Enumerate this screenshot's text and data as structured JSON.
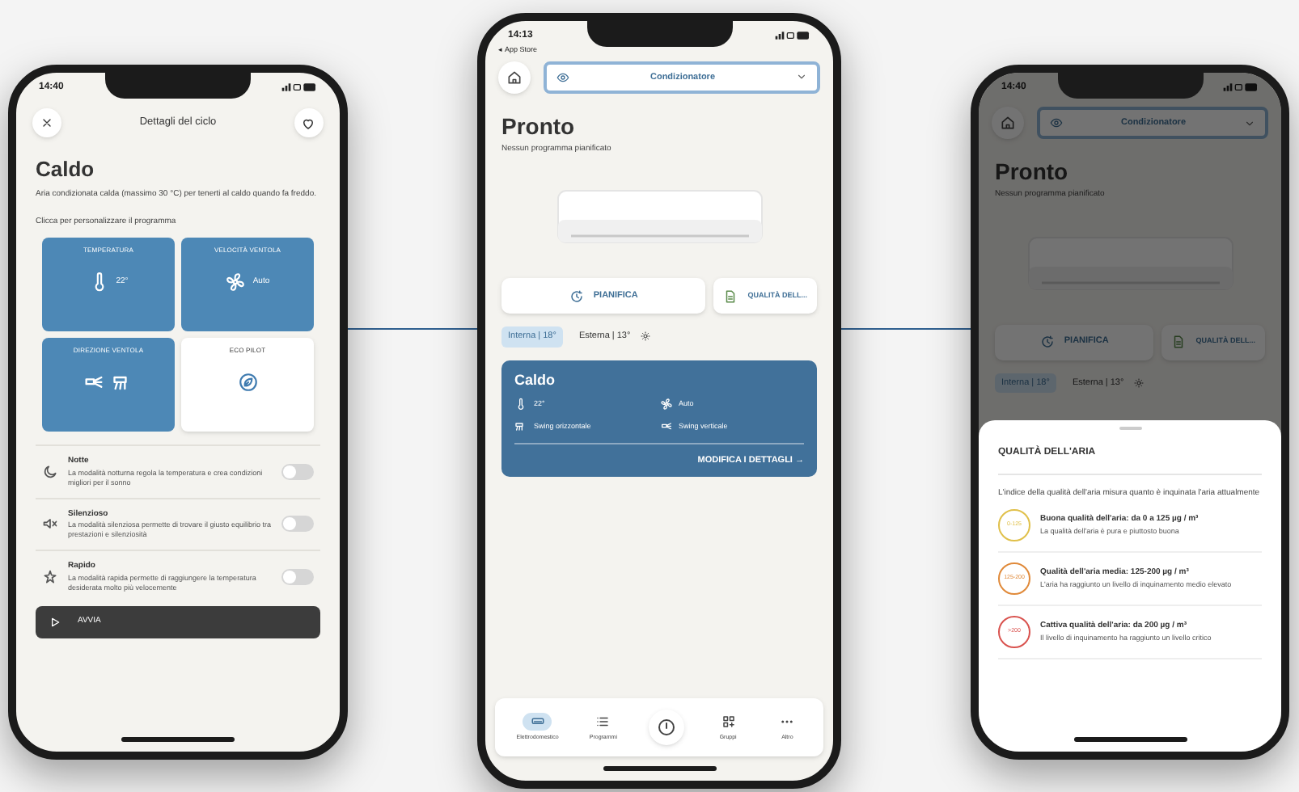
{
  "phones": [
    {
      "kind": "cycle_details",
      "status_time": "14:40",
      "title": "Dettagli del ciclo",
      "heading": "Caldo",
      "description": "Aria condizionata calda (massimo 30 °C) per tenerti al caldo quando fa freddo.",
      "prompt": "Clicca per personalizzare il programma",
      "tiles": [
        {
          "label": "TEMPERATURA",
          "value": "22°",
          "selected": true
        },
        {
          "label": "VELOCITÀ VENTOLA",
          "value": "Auto",
          "selected": true
        },
        {
          "label": "DIREZIONE VENTOLA",
          "selected": true
        },
        {
          "label": "ECO PILOT",
          "selected": false
        }
      ],
      "modes": [
        {
          "name": "Notte",
          "description": "La modalità notturna regola la temperatura e crea condizioni migliori per il sonno",
          "on": false
        },
        {
          "name": "Silenzioso",
          "description": "La modalità silenziosa permette di trovare il giusto equilibrio tra prestazioni e silenziosità",
          "on": false
        },
        {
          "name": "Rapido",
          "description": "La modalità rapida permette di raggiungere la temperatura desiderata molto più velocemente",
          "on": false
        }
      ],
      "start_button": "AVVIA"
    },
    {
      "kind": "home",
      "status_time": "14:13",
      "back_link": "◂ App Store",
      "device": "Condizionatore",
      "heading": "Pronto",
      "subtitle": "Nessun programma pianificato",
      "actions": [
        "PIANIFICA",
        "QUALITÀ DELL..."
      ],
      "temps": [
        {
          "label": "Interna | 18°",
          "selected": true
        },
        {
          "label": "Esterna | 13°",
          "selected": false
        }
      ],
      "card": {
        "title": "Caldo",
        "items": [
          "22°",
          "Auto",
          "Swing orizzontale",
          "Swing verticale"
        ],
        "link": "MODIFICA I DETTAGLI →"
      },
      "nav": [
        {
          "label": "Elettrodomestico",
          "selected": true
        },
        {
          "label": "Programmi",
          "selected": false
        },
        {
          "label": "Gruppi",
          "selected": false
        },
        {
          "label": "Altro",
          "selected": false
        }
      ]
    },
    {
      "kind": "home",
      "status_time": "14:40",
      "device": "Condizionatore",
      "heading": "Pronto",
      "subtitle": "Nessun programma pianificato",
      "actions": [
        "PIANIFICA",
        "QUALITÀ DELL..."
      ],
      "temps": [
        {
          "label": "Interna | 18°",
          "selected": true
        },
        {
          "label": "Esterna | 13°",
          "selected": false
        }
      ],
      "sheet": {
        "title": "QUALITÀ DELL'ARIA",
        "intro": "L'indice della qualità dell'aria misura quanto è inquinata l'aria attualmente",
        "levels": [
          {
            "badge": "0-125",
            "title": "Buona qualità dell'aria: da 0 a 125 µg / m³",
            "description": "La qualità dell'aria è pura e piuttosto buona",
            "color": "#e0c04a"
          },
          {
            "badge": "125-200",
            "title": "Qualità dell'aria media: 125-200 µg / m³",
            "description": "L'aria ha raggiunto un livello di inquinamento medio elevato",
            "color": "#e08a3a"
          },
          {
            "badge": ">200",
            "title": "Cattiva qualità dell'aria: da 200 µg / m³",
            "description": "Il livello di inquinamento ha raggiunto un livello critico",
            "color": "#d9534f"
          }
        ]
      }
    }
  ]
}
